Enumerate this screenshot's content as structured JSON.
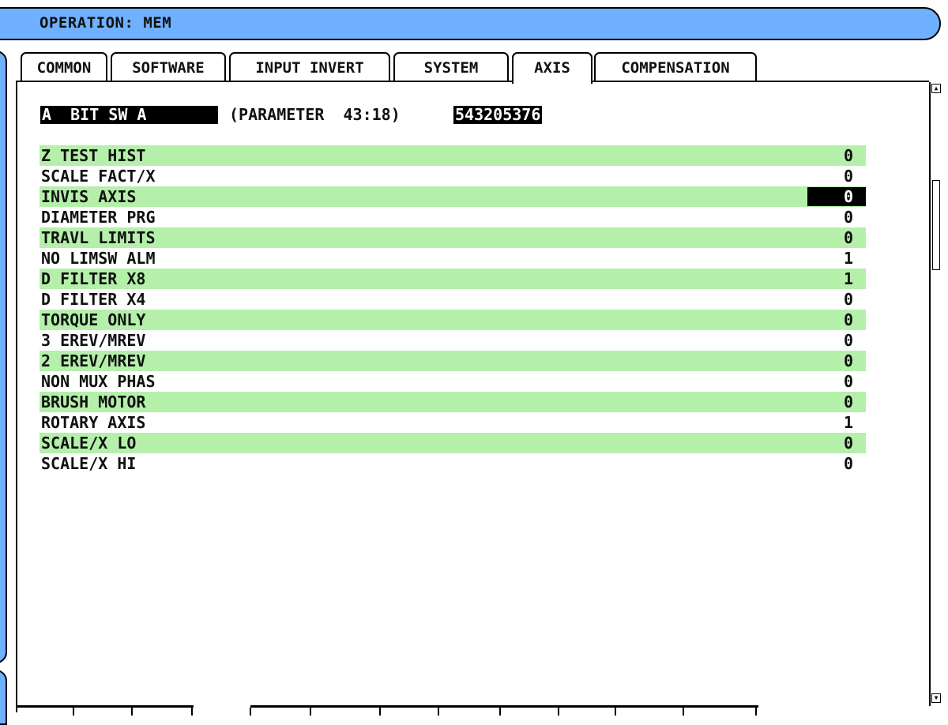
{
  "header": {
    "operation_label": "OPERATION: MEM"
  },
  "tabs": [
    {
      "label": "COMMON",
      "active": false
    },
    {
      "label": "SOFTWARE",
      "active": false
    },
    {
      "label": "INPUT INVERT",
      "active": false
    },
    {
      "label": "SYSTEM",
      "active": false
    },
    {
      "label": "AXIS",
      "active": true
    },
    {
      "label": "COMPENSATION",
      "active": false
    }
  ],
  "parameter": {
    "name": "A  BIT SW A",
    "number_text": "(PARAMETER  43:18)",
    "value": "543205376"
  },
  "rows": [
    {
      "label": "Z TEST HIST",
      "value": "0",
      "highlight": true,
      "selected": false
    },
    {
      "label": "SCALE FACT/X",
      "value": "0",
      "highlight": false,
      "selected": false
    },
    {
      "label": "INVIS AXIS",
      "value": "0",
      "highlight": true,
      "selected": true
    },
    {
      "label": "DIAMETER PRG",
      "value": "0",
      "highlight": false,
      "selected": false
    },
    {
      "label": "TRAVL LIMITS",
      "value": "0",
      "highlight": true,
      "selected": false
    },
    {
      "label": "NO LIMSW ALM",
      "value": "1",
      "highlight": false,
      "selected": false
    },
    {
      "label": "D FILTER X8",
      "value": "1",
      "highlight": true,
      "selected": false
    },
    {
      "label": "D FILTER X4",
      "value": "0",
      "highlight": false,
      "selected": false
    },
    {
      "label": "TORQUE ONLY",
      "value": "0",
      "highlight": true,
      "selected": false
    },
    {
      "label": "3 EREV/MREV",
      "value": "0",
      "highlight": false,
      "selected": false
    },
    {
      "label": "2 EREV/MREV",
      "value": "0",
      "highlight": true,
      "selected": false
    },
    {
      "label": "NON MUX PHAS",
      "value": "0",
      "highlight": false,
      "selected": false
    },
    {
      "label": "BRUSH MOTOR",
      "value": "0",
      "highlight": true,
      "selected": false
    },
    {
      "label": "ROTARY AXIS",
      "value": "1",
      "highlight": false,
      "selected": false
    },
    {
      "label": "SCALE/X LO",
      "value": "0",
      "highlight": true,
      "selected": false
    },
    {
      "label": "SCALE/X HI",
      "value": "0",
      "highlight": false,
      "selected": false
    }
  ],
  "colors": {
    "title_bar": "#6fb0ff",
    "row_highlight": "#b4f0aa",
    "selection": "#000000",
    "background": "#ffffff"
  },
  "icons": {
    "scroll_up": "scroll-up-arrow-icon",
    "scroll_down": "scroll-down-arrow-icon"
  }
}
